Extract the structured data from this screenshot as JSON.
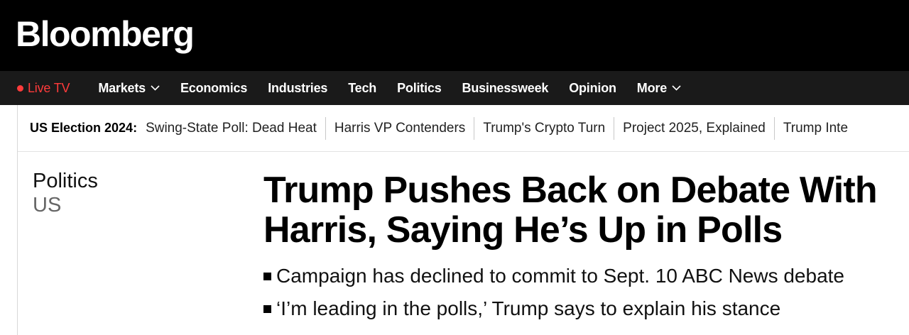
{
  "brand": {
    "logo_text": "Bloomberg"
  },
  "nav": {
    "live_tv": "Live TV",
    "items": [
      {
        "label": "Markets",
        "has_dropdown": true
      },
      {
        "label": "Economics",
        "has_dropdown": false
      },
      {
        "label": "Industries",
        "has_dropdown": false
      },
      {
        "label": "Tech",
        "has_dropdown": false
      },
      {
        "label": "Politics",
        "has_dropdown": false
      },
      {
        "label": "Businessweek",
        "has_dropdown": false
      },
      {
        "label": "Opinion",
        "has_dropdown": false
      },
      {
        "label": "More",
        "has_dropdown": true
      }
    ]
  },
  "election_bar": {
    "label": "US Election 2024:",
    "links": [
      "Swing-State Poll: Dead Heat",
      "Harris VP Contenders",
      "Trump's Crypto Turn",
      "Project 2025, Explained",
      "Trump Inte"
    ]
  },
  "article": {
    "kicker_primary": "Politics",
    "kicker_secondary": "US",
    "headline": "Trump Pushes Back on Debate With Harris, Saying He’s Up in Polls",
    "bullets": [
      "Campaign has declined to commit to Sept. 10 ABC News debate",
      "‘I’m leading in the polls,’ Trump says to explain his stance"
    ]
  },
  "colors": {
    "header_bg": "#000000",
    "nav_bg": "#1a1a1a",
    "live_red": "#ff3b3b"
  }
}
